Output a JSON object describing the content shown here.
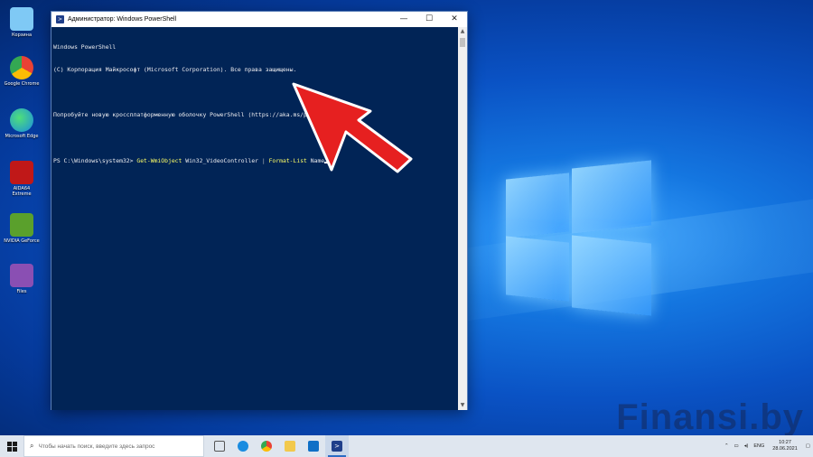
{
  "desktop": {
    "icons": [
      {
        "label": "Корзина",
        "color": "#7fc9f5"
      },
      {
        "label": "Google Chrome",
        "color": "#e94235"
      },
      {
        "label": "Microsoft Edge",
        "color": "#1a8ce0"
      },
      {
        "label": "AIDA64 Extreme",
        "color": "#c01818"
      },
      {
        "label": "NVIDIA GeForce",
        "color": "#5aa02c"
      },
      {
        "label": "Files",
        "color": "#8a4fb3"
      }
    ],
    "watermark": "Finansi.by"
  },
  "powershell": {
    "title": "Администратор: Windows PowerShell",
    "icon": "powershell-icon",
    "controls": {
      "minimize": "—",
      "maximize": "☐",
      "close": "✕"
    },
    "console": {
      "line1": "Windows PowerShell",
      "line2": "(С) Корпорация Майкрософт (Microsoft Corporation). Все права защищены.",
      "line3": "Попробуйте новую кроссплатформенную оболочку PowerShell (https://aka.ms/pscore6)",
      "prompt": "PS C:\\Windows\\system32> ",
      "cmd1": "Get-WmiObject",
      "arg1": " Win32_VideoController ",
      "pipe": "|",
      "cmd2": " Format-List",
      "arg2": " Name"
    },
    "colors": {
      "background": "#012456",
      "text": "#eeedf0",
      "command": "#ffff66"
    }
  },
  "annotation": {
    "type": "red-arrow",
    "color": "#e62020"
  },
  "taskbar": {
    "search_placeholder": "Чтобы начать поиск, введите здесь запрос",
    "apps": [
      {
        "name": "task-view",
        "color": "#555555"
      },
      {
        "name": "edge",
        "color": "#1a8ce0"
      },
      {
        "name": "chrome",
        "color": "#e94235"
      },
      {
        "name": "file-explorer",
        "color": "#f2c94c"
      },
      {
        "name": "mail",
        "color": "#0f6fc6"
      },
      {
        "name": "powershell",
        "color": "#1f3f8a"
      }
    ],
    "tray": {
      "language": "ENG",
      "time": "10:27",
      "date": "28.06.2021"
    }
  }
}
